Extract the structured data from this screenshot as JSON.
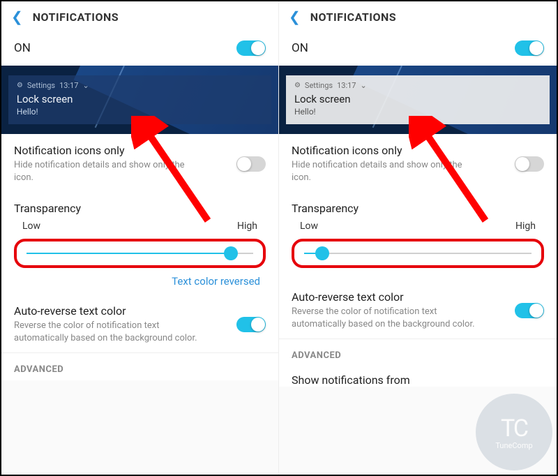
{
  "left": {
    "header": {
      "title": "NOTIFICATIONS"
    },
    "toggle": {
      "label": "ON",
      "state": "on"
    },
    "preview": {
      "app": "Settings",
      "time": "13:17",
      "title": "Lock screen",
      "body": "Hello!",
      "style": "dark"
    },
    "icons_only": {
      "title": "Notification icons only",
      "desc": "Hide notification details and show only the icon.",
      "state": "off"
    },
    "transparency": {
      "title": "Transparency",
      "low": "Low",
      "high": "High",
      "value": 90,
      "reversed_label": "Text color reversed"
    },
    "auto_reverse": {
      "title": "Auto-reverse text color",
      "desc": "Reverse the color of notification text automatically based on the background color.",
      "state": "on"
    },
    "advanced": "ADVANCED"
  },
  "right": {
    "header": {
      "title": "NOTIFICATIONS"
    },
    "toggle": {
      "label": "ON",
      "state": "on"
    },
    "preview": {
      "app": "Settings",
      "time": "13:17",
      "title": "Lock screen",
      "body": "Hello!",
      "style": "light"
    },
    "icons_only": {
      "title": "Notification icons only",
      "desc": "Hide notification details and show only the icon.",
      "state": "off"
    },
    "transparency": {
      "title": "Transparency",
      "low": "Low",
      "high": "High",
      "value": 8
    },
    "auto_reverse": {
      "title": "Auto-reverse text color",
      "desc": "Reverse the color of notification text automatically based on the background color.",
      "state": "on"
    },
    "advanced": "ADVANCED",
    "show_from": "Show notifications from"
  },
  "watermark": {
    "initials": "TC",
    "label": "TuneComp"
  }
}
